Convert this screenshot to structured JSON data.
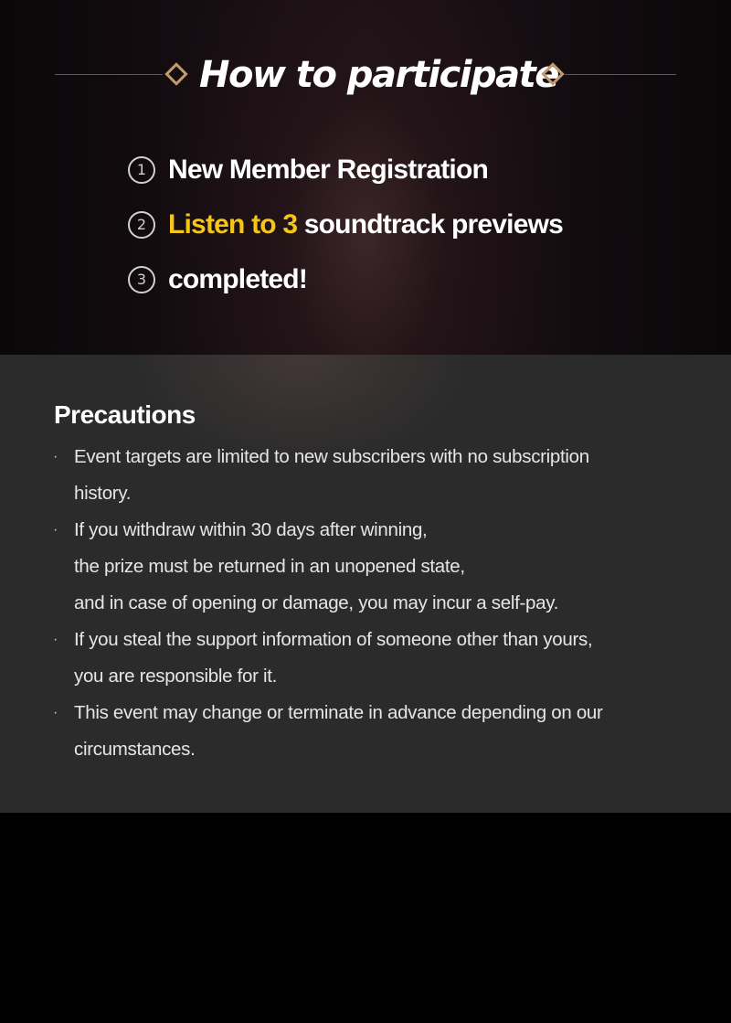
{
  "header": {
    "title": "How to participate"
  },
  "steps": [
    {
      "number": "1",
      "text": "New Member Registration"
    },
    {
      "number": "2",
      "highlight": "Listen to 3",
      "text": " soundtrack previews"
    },
    {
      "number": "3",
      "text": "completed!"
    }
  ],
  "precautions": {
    "title": "Precautions",
    "bullet": "·",
    "items": [
      {
        "lines": [
          "Event targets are limited to new subscribers with no subscription",
          "history."
        ]
      },
      {
        "lines": [
          "If you withdraw within 30 days after winning,",
          "the prize must be returned in an unopened state,",
          "and in case of opening or damage, you may incur a self-pay."
        ]
      },
      {
        "lines": [
          "If you steal the support information of someone other than yours,",
          "you are responsible for it."
        ]
      },
      {
        "lines": [
          "This event may change or terminate in advance depending on our",
          "circumstances."
        ]
      }
    ]
  },
  "colors": {
    "accent_gold": "#c49a6c",
    "highlight_yellow": "#f5c518",
    "panel_gray": "#2b2b2b"
  }
}
